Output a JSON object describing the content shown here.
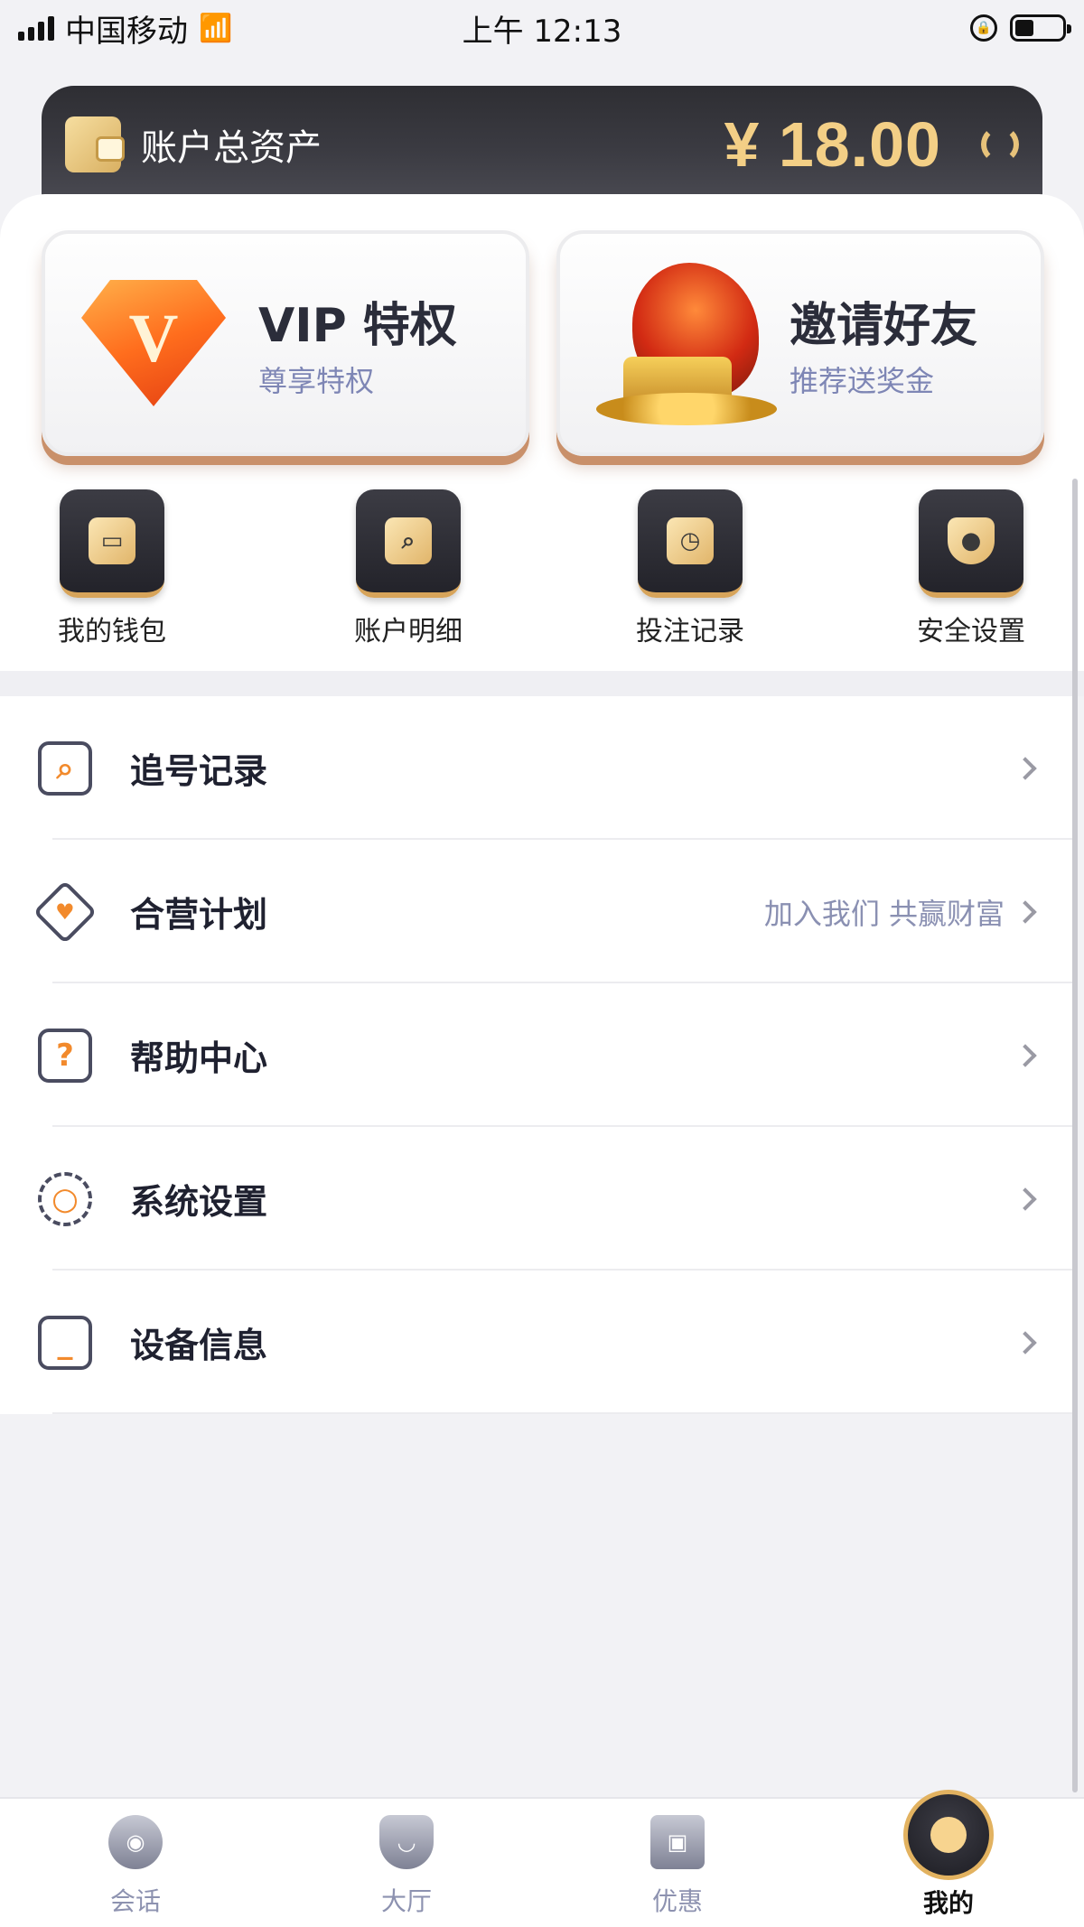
{
  "status_bar": {
    "carrier": "中国移动",
    "time": "上午 12:13"
  },
  "balance": {
    "label": "账户总资产",
    "amount": "¥ 18.00"
  },
  "promos": [
    {
      "title": "VIP 特权",
      "subtitle": "尊享特权",
      "icon": "diamond-v-icon"
    },
    {
      "title": "邀请好友",
      "subtitle": "推荐送奖金",
      "icon": "dragon-treasure-icon"
    }
  ],
  "quick_actions": [
    {
      "label": "我的钱包",
      "icon": "wallet-icon"
    },
    {
      "label": "账户明细",
      "icon": "search-document-icon"
    },
    {
      "label": "投注记录",
      "icon": "clock-document-icon"
    },
    {
      "label": "安全设置",
      "icon": "shield-lock-icon"
    }
  ],
  "menu": [
    {
      "label": "追号记录",
      "hint": "",
      "icon": "search-list-icon"
    },
    {
      "label": "合营计划",
      "hint": "加入我们 共赢财富",
      "icon": "handshake-heart-icon"
    },
    {
      "label": "帮助中心",
      "hint": "",
      "icon": "question-icon"
    },
    {
      "label": "系统设置",
      "hint": "",
      "icon": "gear-icon"
    },
    {
      "label": "设备信息",
      "hint": "",
      "icon": "device-icon"
    }
  ],
  "tabs": [
    {
      "label": "会话",
      "icon": "headset-icon",
      "active": false
    },
    {
      "label": "大厅",
      "icon": "lobby-icon",
      "active": false
    },
    {
      "label": "优惠",
      "icon": "gift-icon",
      "active": false
    },
    {
      "label": "我的",
      "icon": "user-icon",
      "active": true
    }
  ],
  "colors": {
    "accent_gold": "#f3cf86",
    "hint_text": "#8a90b2",
    "orange": "#f28a2c"
  }
}
